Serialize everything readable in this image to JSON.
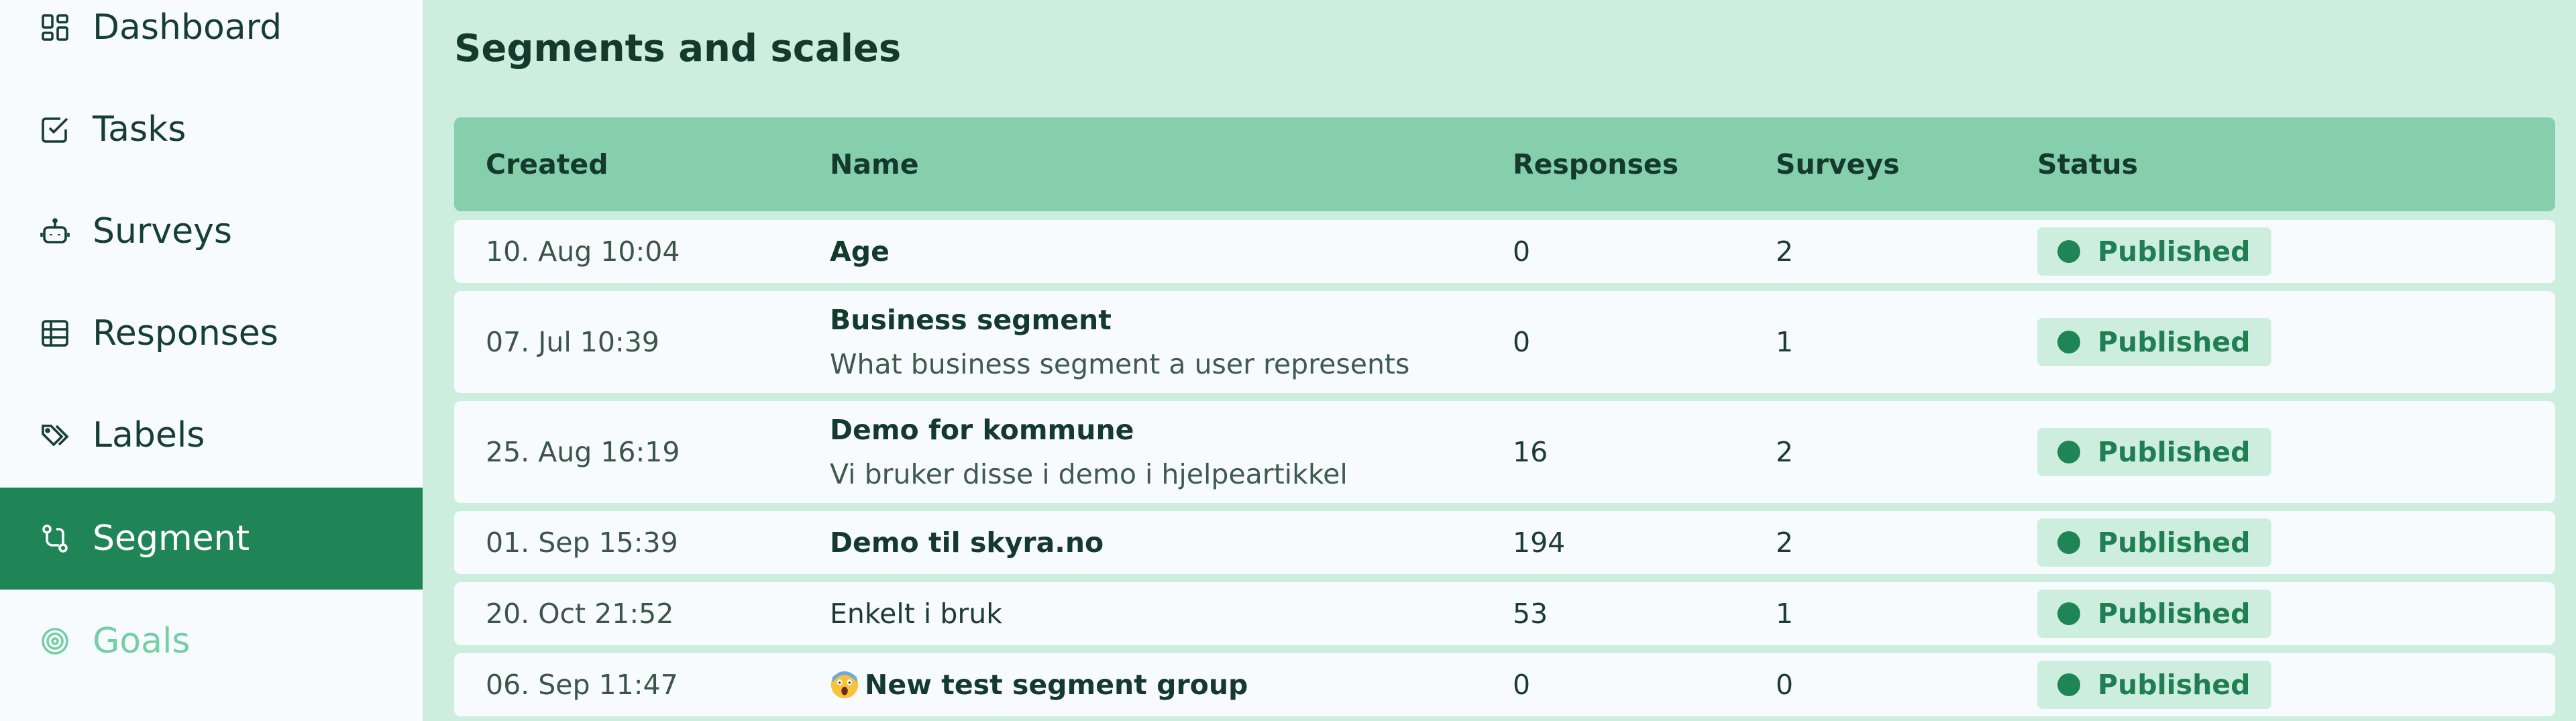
{
  "sidebar": {
    "items": [
      {
        "label": "Dashboard",
        "icon": "dashboard-icon",
        "active": false
      },
      {
        "label": "Tasks",
        "icon": "tasks-icon",
        "active": false
      },
      {
        "label": "Surveys",
        "icon": "surveys-icon",
        "active": false
      },
      {
        "label": "Responses",
        "icon": "responses-icon",
        "active": false
      },
      {
        "label": "Labels",
        "icon": "labels-icon",
        "active": false
      },
      {
        "label": "Segment",
        "icon": "segment-icon",
        "active": true
      },
      {
        "label": "Goals",
        "icon": "goals-icon",
        "active": false
      }
    ]
  },
  "main": {
    "title": "Segments and scales",
    "columns": [
      "Created",
      "Name",
      "Responses",
      "Surveys",
      "Status"
    ],
    "rows": [
      {
        "created": "10. Aug 10:04",
        "name": "Age",
        "description": "",
        "responses": "0",
        "surveys": "2",
        "status": "Published"
      },
      {
        "created": "07. Jul 10:39",
        "name": "Business segment",
        "description": "What business segment a user represents",
        "responses": "0",
        "surveys": "1",
        "status": "Published"
      },
      {
        "created": "25. Aug 16:19",
        "name": "Demo for kommune",
        "description": "Vi bruker disse i demo i hjelpeartikkel",
        "responses": "16",
        "surveys": "2",
        "status": "Published"
      },
      {
        "created": "01. Sep 15:39",
        "name": "Demo til skyra.no",
        "description": "",
        "responses": "194",
        "surveys": "2",
        "status": "Published"
      },
      {
        "created": "20. Oct 21:52",
        "name": "Enkelt i bruk",
        "description": "",
        "responses": "53",
        "surveys": "1",
        "status": "Published"
      },
      {
        "created": "06. Sep 11:47",
        "name": "New test segment group",
        "name_emoji": "screaming-face-emoji",
        "description": "",
        "responses": "0",
        "surveys": "0",
        "status": "Published"
      }
    ]
  },
  "colors": {
    "accent": "#208556",
    "header_bg": "#85cfad",
    "page_bg": "#cdeedf",
    "badge_bg": "#cdeedf",
    "muted_nav": "#74cfa5"
  }
}
